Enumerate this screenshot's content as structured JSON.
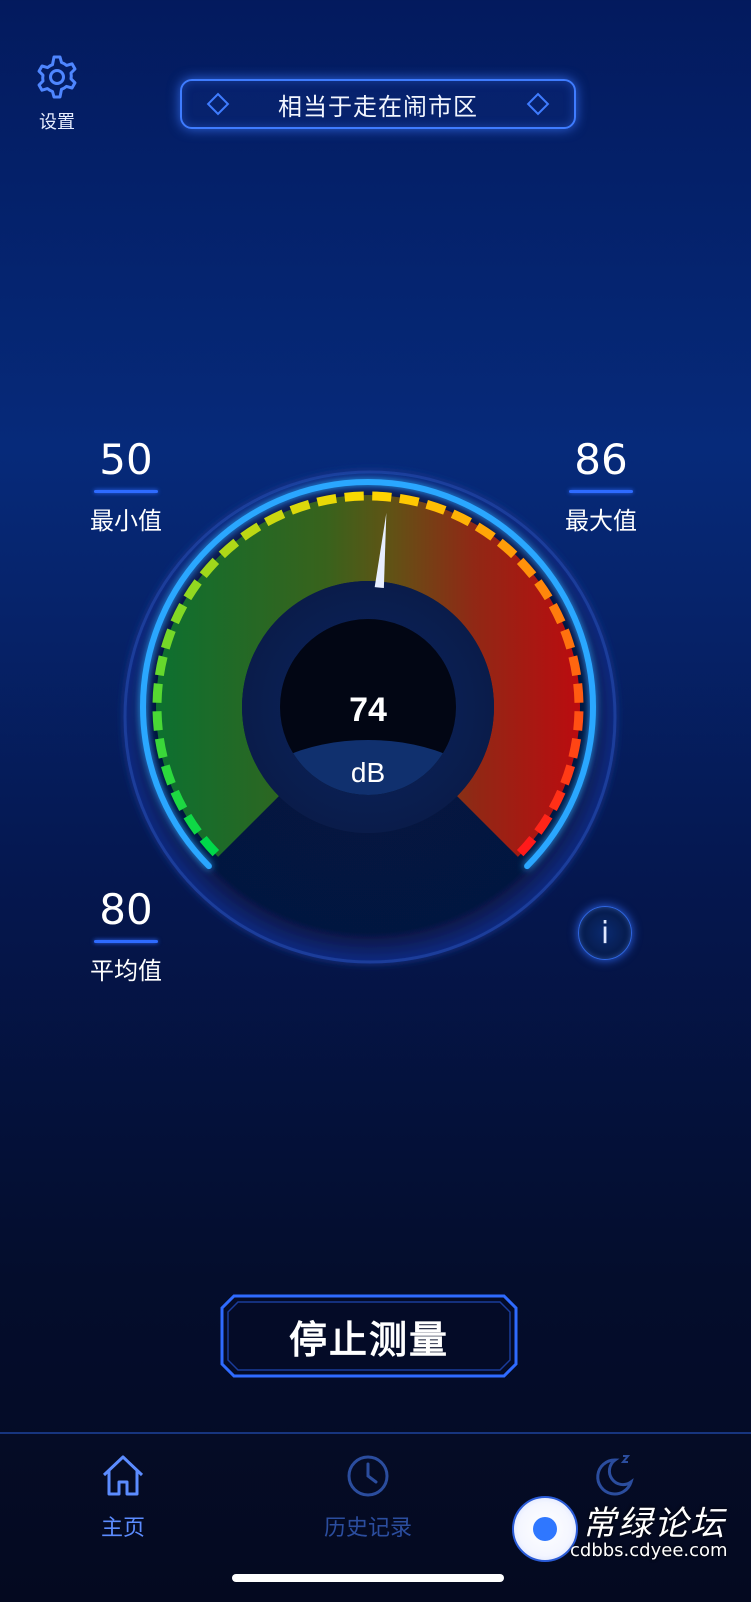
{
  "settings": {
    "label": "设置",
    "icon": "gear-icon"
  },
  "status_banner": {
    "text": "相当于走在闹市区"
  },
  "stats": {
    "min": {
      "value": "50",
      "label": "最小值"
    },
    "max": {
      "value": "86",
      "label": "最大值"
    },
    "avg": {
      "value": "80",
      "label": "平均值"
    }
  },
  "gauge": {
    "reading": "74",
    "unit": "dB",
    "needle_level": 0.52,
    "colors": {
      "low": "#00d84a",
      "mid": "#ffd800",
      "high": "#ff1a1a",
      "ring": "#2aa7ff"
    }
  },
  "info": {
    "label": "i"
  },
  "stop_button": {
    "label": "停止测量"
  },
  "tabs": [
    {
      "label": "主页",
      "icon": "home-icon",
      "active": true
    },
    {
      "label": "历史记录",
      "icon": "clock-icon",
      "active": false
    },
    {
      "label": "",
      "icon": "moon-icon",
      "active": false
    }
  ],
  "watermark": {
    "brand": "常绿论坛",
    "url": "cdbbs.cdyee.com"
  },
  "colors": {
    "accent": "#3f7cff",
    "background_top": "#031a5e",
    "background_bottom": "#040a22"
  }
}
